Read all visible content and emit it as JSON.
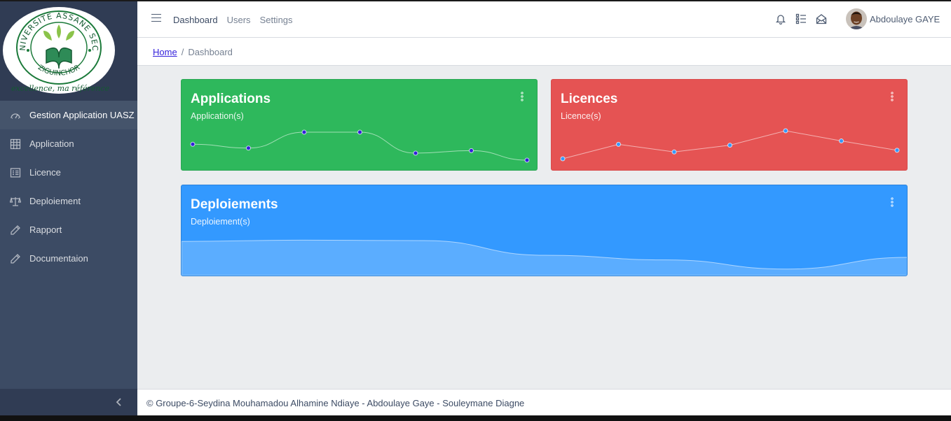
{
  "app": {
    "logo": {
      "text_top": "UNIVERSITE ASSANE SECK",
      "text_bottom": "ZIGUINCHOR",
      "motto": "excellence, ma référence"
    }
  },
  "sidebar": {
    "items": [
      {
        "label": "Gestion Application UASZ",
        "icon": "speedometer-icon",
        "active": true
      },
      {
        "label": "Application",
        "icon": "grid-icon"
      },
      {
        "label": "Licence",
        "icon": "list-icon"
      },
      {
        "label": "Deploiement",
        "icon": "balance-scale-icon"
      },
      {
        "label": "Rapport",
        "icon": "pencil-icon"
      },
      {
        "label": "Documentaion",
        "icon": "pencil-icon"
      }
    ],
    "minimizer_icon": "chevron-left-icon"
  },
  "header": {
    "nav": [
      "Dashboard",
      "Users",
      "Settings"
    ],
    "icons": [
      "bell-icon",
      "task-list-icon",
      "envelope-open-icon"
    ],
    "user_name": "Abdoulaye GAYE"
  },
  "breadcrumb": {
    "home": "Home",
    "separator": "/",
    "current": "Dashboard"
  },
  "cards": {
    "applications": {
      "title": "Applications",
      "subtitle": "Application(s)",
      "color": "#2eb85c"
    },
    "licences": {
      "title": "Licences",
      "subtitle": "Licence(s)",
      "color": "#e55353"
    },
    "deploiements": {
      "title": "Deploiements",
      "subtitle": "Deploiement(s)",
      "color": "#3399ff"
    }
  },
  "chart_data": [
    {
      "type": "line",
      "name": "applications-sparkline",
      "values": [
        65,
        59,
        84,
        84,
        51,
        55,
        40
      ]
    },
    {
      "type": "line",
      "name": "licences-sparkline",
      "values": [
        1,
        18,
        9,
        17,
        34,
        22,
        11
      ]
    },
    {
      "type": "area",
      "name": "deploiements-sparkline",
      "values": [
        78,
        81,
        80,
        45,
        34,
        12,
        40
      ]
    }
  ],
  "footer": {
    "text": "© Groupe-6-Seydina Mouhamadou Alhamine Ndiaye - Abdoulaye Gaye - Souleymane Diagne"
  }
}
